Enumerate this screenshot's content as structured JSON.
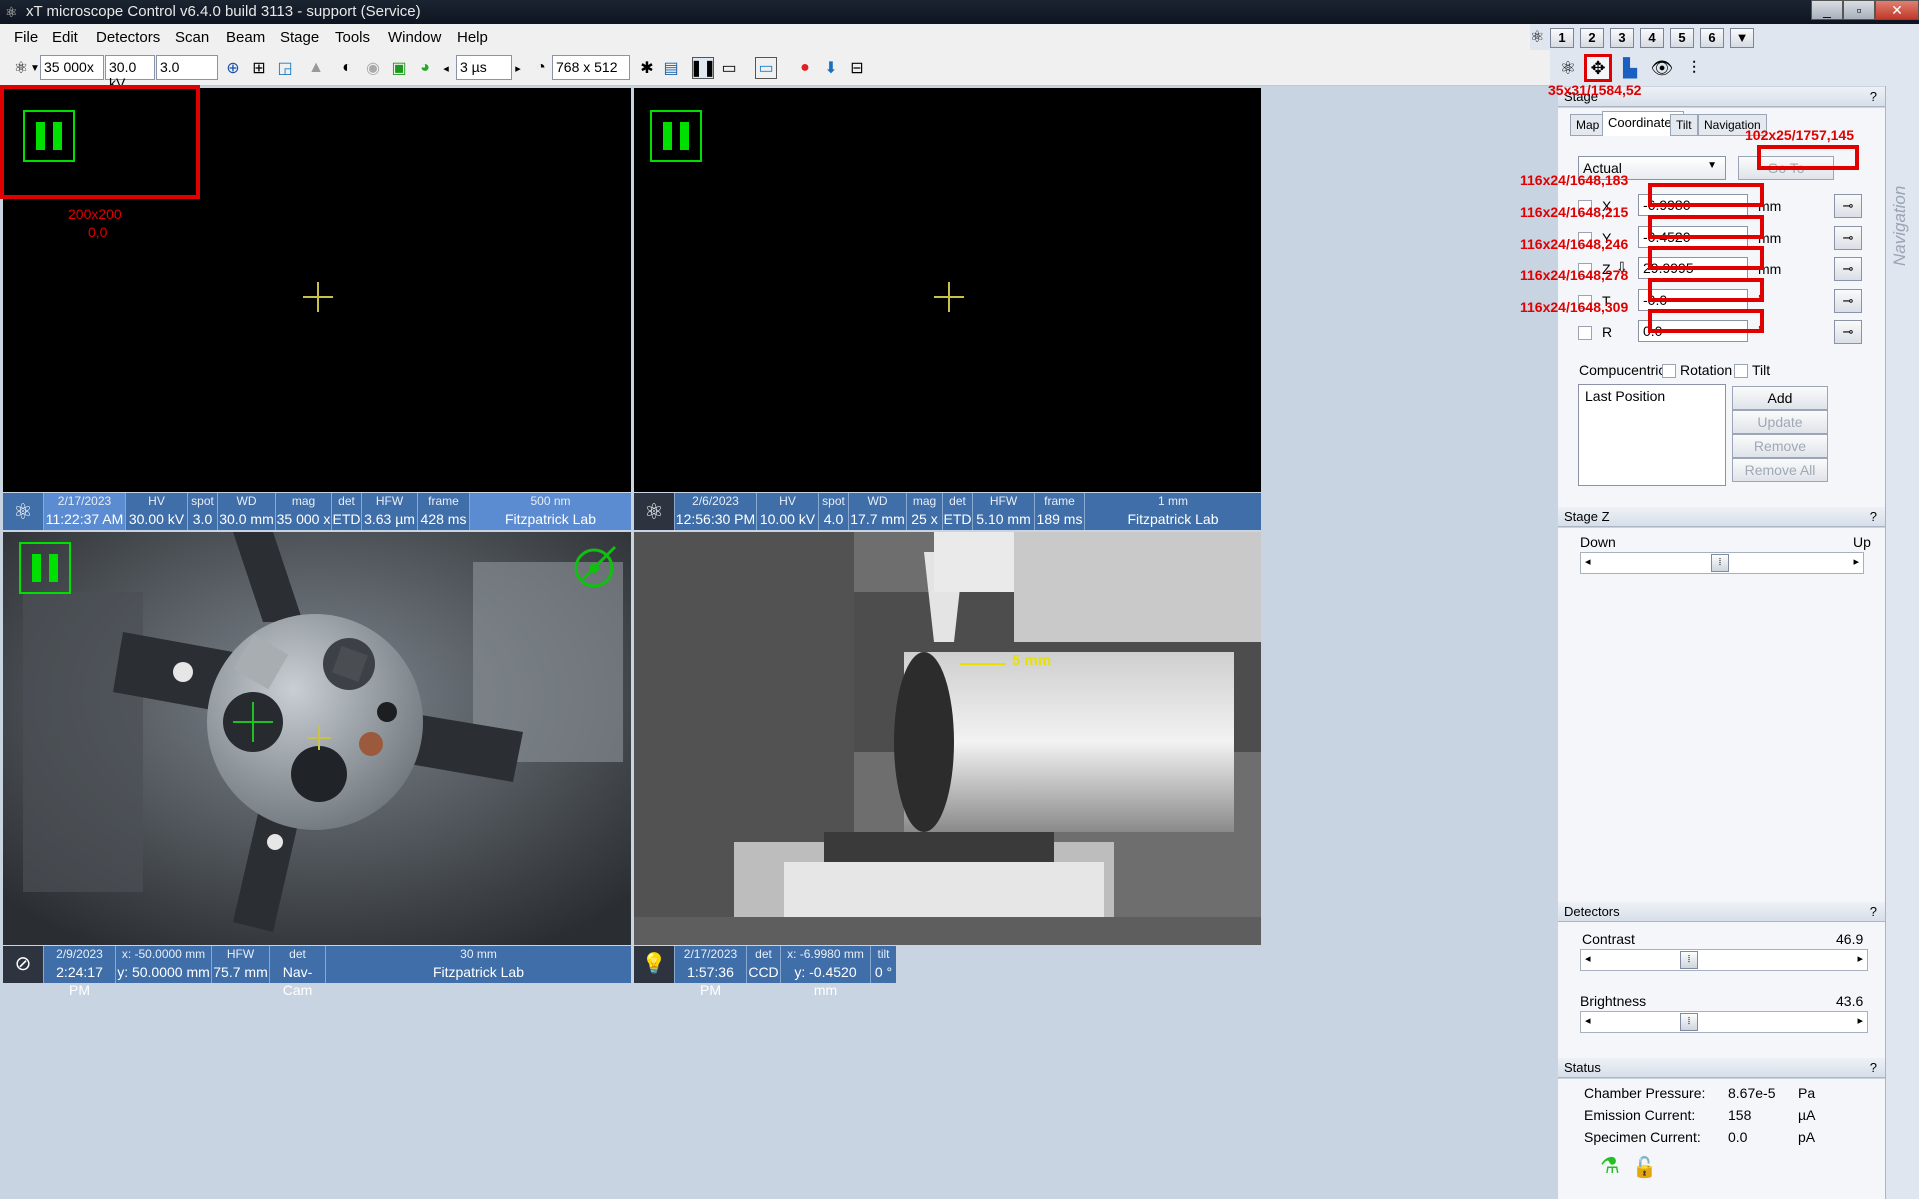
{
  "titlebar": {
    "title": "xT microscope Control v6.4.0 build 3113 - support (Service)",
    "minimize": "_",
    "restore": "▫",
    "close": "✕"
  },
  "menu": [
    "File",
    "Edit",
    "Detectors",
    "Scan",
    "Beam",
    "Stage",
    "Tools",
    "Window",
    "Help"
  ],
  "toolbar": {
    "magnification": "35 000x",
    "voltage": "30.0 kV",
    "spot": "3.0",
    "dwell": "3 µs",
    "resolution": "768 x 512"
  },
  "presets": [
    "1",
    "2",
    "3",
    "4",
    "5",
    "6",
    "▼"
  ],
  "quads": [
    {
      "bar": {
        "date": "2/17/2023",
        "time": "11:22:37 AM",
        "hv_h": "HV",
        "hv": "30.00 kV",
        "spot_h": "spot",
        "spot": "3.0",
        "wd_h": "WD",
        "wd": "30.0 mm",
        "mag_h": "mag",
        "mag": "35 000 x",
        "det_h": "det",
        "det": "ETD",
        "hfw_h": "HFW",
        "hfw": "3.63 µm",
        "frame_h": "frame",
        "frame": "428 ms",
        "scale": "500 nm",
        "lab": "Fitzpatrick Lab"
      }
    },
    {
      "bar": {
        "date": "2/6/2023",
        "time": "12:56:30 PM",
        "hv_h": "HV",
        "hv": "10.00 kV",
        "spot_h": "spot",
        "spot": "4.0",
        "wd_h": "WD",
        "wd": "17.7 mm",
        "mag_h": "mag",
        "mag": "25 x",
        "det_h": "det",
        "det": "ETD",
        "hfw_h": "HFW",
        "hfw": "5.10 mm",
        "frame_h": "frame",
        "frame": "189 ms",
        "scale": "1 mm",
        "lab": "Fitzpatrick Lab"
      }
    },
    {
      "bar": {
        "date": "2/9/2023",
        "time": "2:24:17 PM",
        "x": "x: -50.0000 mm",
        "y": "y: 50.0000 mm",
        "hfw_h": "HFW",
        "hfw": "75.7 mm",
        "det_h": "det",
        "det": "Nav-Cam",
        "scale": "30 mm",
        "lab": "Fitzpatrick Lab"
      }
    },
    {
      "bar": {
        "date": "2/17/2023",
        "time": "1:57:36 PM",
        "det_h": "det",
        "det": "CCD",
        "x": "x: -6.9980 mm",
        "y": "y: -0.4520 mm",
        "tilt_h": "tilt",
        "tilt": "0 °"
      },
      "scale": "5 mm"
    }
  ],
  "stage": {
    "header": "Stage",
    "help": "?",
    "tabs": [
      "Map",
      "Coordinates",
      "Tilt",
      "Navigation"
    ],
    "mode": "Actual",
    "goto": "Go To",
    "coords": [
      {
        "label": "X",
        "value": "-6.9980",
        "unit": "mm"
      },
      {
        "label": "Y",
        "value": "-0.4520",
        "unit": "mm"
      },
      {
        "label": "Z",
        "value": "29.9995",
        "unit": "mm"
      },
      {
        "label": "T",
        "value": "-0.0",
        "unit": "°"
      },
      {
        "label": "R",
        "value": "0.0",
        "unit": "°"
      }
    ],
    "compucentric": "Compucentric:",
    "rotation": "Rotation",
    "tilt": "Tilt",
    "positions": [
      "Last Position"
    ],
    "buttons": {
      "add": "Add",
      "update": "Update",
      "remove": "Remove",
      "remove_all": "Remove All"
    }
  },
  "stage_z": {
    "header": "Stage Z",
    "down": "Down",
    "up": "Up"
  },
  "detectors": {
    "header": "Detectors",
    "contrast_label": "Contrast",
    "contrast": "46.9",
    "brightness_label": "Brightness",
    "brightness": "43.6",
    "contrast_level": 0.38,
    "brightness_level": 0.38
  },
  "status": {
    "header": "Status",
    "rows": [
      {
        "label": "Chamber Pressure:",
        "value": "8.67e-5",
        "unit": "Pa"
      },
      {
        "label": "Emission Current:",
        "value": "158",
        "unit": "µA"
      },
      {
        "label": "Specimen Current:",
        "value": "0.0",
        "unit": "pA"
      }
    ]
  },
  "nav_strip": "Navigation",
  "annotations": {
    "a1": "200x200",
    "a1b": "0,0",
    "a2": "35x31/1584,52",
    "a3": "102x25/1757,145",
    "a4": "116x24/1648,183",
    "a5": "116x24/1648,215",
    "a6": "116x24/1648,246",
    "a7": "116x24/1648,278",
    "a8": "116x24/1648,309"
  },
  "colors": {
    "infobar": "#3f6ea8",
    "annotation": "#e00000",
    "crosshair": "#c8c24a",
    "pause": "#00e000"
  }
}
